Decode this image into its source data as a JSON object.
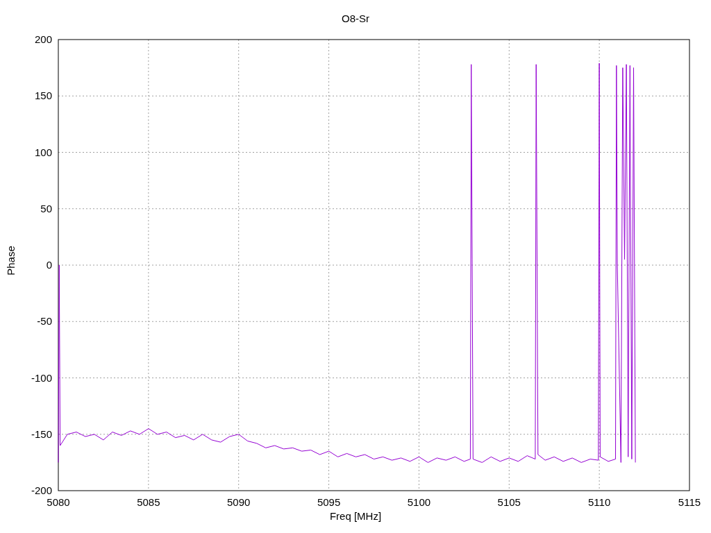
{
  "chart_data": {
    "type": "line",
    "title": "O8-Sr",
    "xlabel": "Freq [MHz]",
    "ylabel": "Phase",
    "grid": true,
    "xlim": [
      5080,
      5115
    ],
    "ylim": [
      -200,
      200
    ],
    "xticks": [
      5080,
      5085,
      5090,
      5095,
      5100,
      5105,
      5110,
      5115
    ],
    "yticks": [
      -200,
      -150,
      -100,
      -50,
      0,
      50,
      100,
      150,
      200
    ],
    "x": [
      5080,
      5080.05,
      5080.1,
      5080.5,
      5081,
      5081.5,
      5082,
      5082.5,
      5083,
      5083.5,
      5084,
      5084.5,
      5085,
      5085.5,
      5086,
      5086.5,
      5087,
      5087.5,
      5088,
      5088.5,
      5089,
      5089.5,
      5090,
      5090.5,
      5091,
      5091.5,
      5092,
      5092.5,
      5093,
      5093.5,
      5094,
      5094.5,
      5095,
      5095.5,
      5096,
      5096.5,
      5097,
      5097.5,
      5098,
      5098.5,
      5099,
      5099.5,
      5100,
      5100.5,
      5101,
      5101.5,
      5102,
      5102.5,
      5102.85,
      5102.9,
      5102.95,
      5103,
      5103.5,
      5104,
      5104.5,
      5105,
      5105.5,
      5106,
      5106.45,
      5106.5,
      5106.55,
      5106.6,
      5107,
      5107.5,
      5108,
      5108.5,
      5109,
      5109.5,
      5109.95,
      5110,
      5110.05,
      5110.5,
      5110.9,
      5110.95,
      5111,
      5111.2,
      5111.3,
      5111.4,
      5111.5,
      5111.6,
      5111.7,
      5111.8,
      5111.9,
      5111.95,
      5112
    ],
    "series": [
      {
        "color": "#9400d3",
        "values": [
          -175,
          0,
          -160,
          -150,
          -148,
          -152,
          -150,
          -155,
          -148,
          -151,
          -147,
          -150,
          -145,
          -150,
          -148,
          -153,
          -151,
          -155,
          -150,
          -155,
          -157,
          -152,
          -150,
          -156,
          -158,
          -162,
          -160,
          -163,
          -162,
          -165,
          -164,
          -168,
          -165,
          -170,
          -167,
          -170,
          -168,
          -172,
          -170,
          -173,
          -171,
          -174,
          -170,
          -175,
          -171,
          -173,
          -170,
          -174,
          -172,
          178,
          5,
          -172,
          -175,
          -170,
          -174,
          -171,
          -174,
          -169,
          -172,
          178,
          3,
          -168,
          -173,
          -170,
          -174,
          -171,
          -175,
          -172,
          -173,
          179,
          -170,
          -174,
          -172,
          177,
          0,
          -175,
          175,
          5,
          178,
          -170,
          177,
          -172,
          175,
          0,
          -175
        ]
      }
    ]
  }
}
